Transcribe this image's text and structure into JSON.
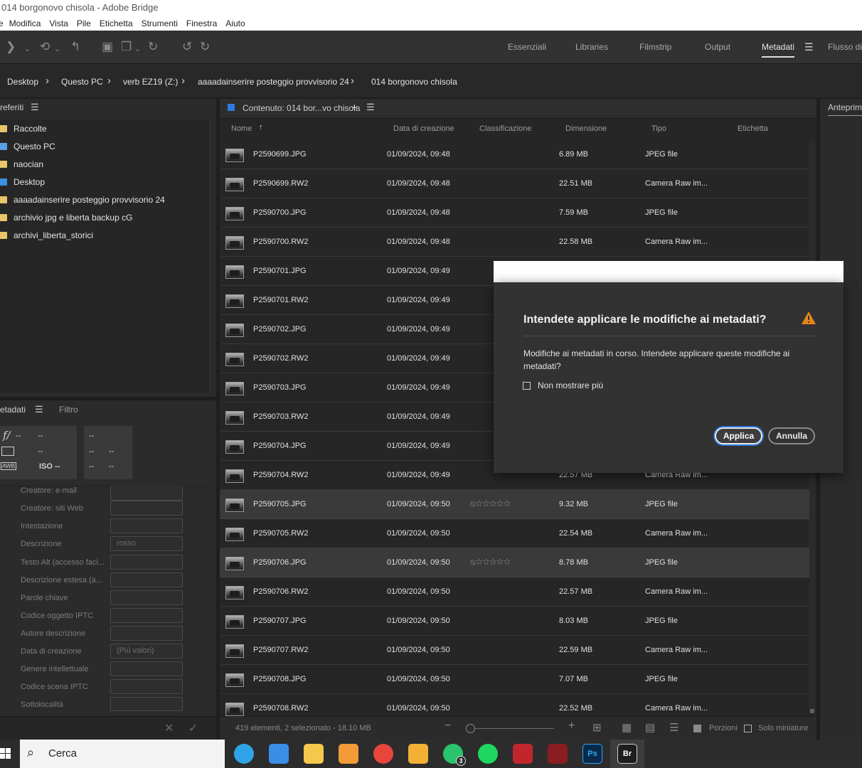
{
  "window": {
    "title": "014 borgonovo chisola - Adobe Bridge"
  },
  "menu": [
    "e",
    "Modifica",
    "Vista",
    "Pile",
    "Etichetta",
    "Strumenti",
    "Finestra",
    "Aiuto"
  ],
  "workspaces": [
    "Essenziali",
    "Libraries",
    "Filmstrip",
    "Output",
    "Metadati",
    "Flusso di l"
  ],
  "active_workspace": "Metadati",
  "breadcrumb": [
    "Desktop",
    "Questo PC",
    "verb EZ19 (Z:)",
    "aaaadainserire posteggio provvisorio 24",
    "014 borgonovo chisola"
  ],
  "favorites": {
    "tab": "referiti",
    "items": [
      {
        "label": "Raccolte",
        "icon": "collections-folder-icon",
        "color": "#e8c46a"
      },
      {
        "label": "Questo PC",
        "icon": "pc-icon",
        "color": "#5aa0e6"
      },
      {
        "label": "naocian",
        "icon": "folder-icon",
        "color": "#e8c46a"
      },
      {
        "label": "Desktop",
        "icon": "desktop-folder-icon",
        "color": "#3b8fe0"
      },
      {
        "label": "aaaadainserire posteggio provvisorio 24",
        "icon": "folder-icon",
        "color": "#e8c46a"
      },
      {
        "label": "archivio jpg e liberta backup cG",
        "icon": "folder-icon",
        "color": "#e8c46a"
      },
      {
        "label": "archivi_liberta_storici",
        "icon": "folder-icon",
        "color": "#e8c46a"
      }
    ]
  },
  "metadata_panel": {
    "tab_metadata": "etadati",
    "tab_filter": "Filtro",
    "camera": {
      "aperture_icon": "f/",
      "aperture": "--",
      "value2": "--",
      "metering": "--",
      "awb": "AWB",
      "iso": "ISO --",
      "b1": "--",
      "b2": "--",
      "b3": "--",
      "b4": "--",
      "b5": "--"
    },
    "fields": [
      {
        "label": "Creatore: e-mail",
        "value": ""
      },
      {
        "label": "Creatore: siti Web",
        "value": ""
      },
      {
        "label": "Intestazione",
        "value": ""
      },
      {
        "label": "Descrizione",
        "value": "rosso"
      },
      {
        "label": "Testo Alt (accesso faci...",
        "value": ""
      },
      {
        "label": "Descrizione estesa (a...",
        "value": ""
      },
      {
        "label": "Parole chiave",
        "value": ""
      },
      {
        "label": "Codice oggetto IPTC",
        "value": ""
      },
      {
        "label": "Autore descrizione",
        "value": ""
      },
      {
        "label": "Data di creazione",
        "value": "(Più valori)"
      },
      {
        "label": "Genere intellettuale",
        "value": ""
      },
      {
        "label": "Codice scena IPTC",
        "value": ""
      },
      {
        "label": "Sottolocalità",
        "value": ""
      }
    ]
  },
  "content": {
    "header": "Contenuto: 014 bor...vo chisola",
    "columns": [
      "Nome",
      "Data di creazione",
      "Classificazione",
      "Dimensione",
      "Tipo",
      "Etichetta"
    ],
    "rows": [
      {
        "name": "P2590699.JPG",
        "date": "01/09/2024, 09:48",
        "rating": "",
        "size": "6.89 MB",
        "type": "JPEG file",
        "selected": false
      },
      {
        "name": "P2590699.RW2",
        "date": "01/09/2024, 09:48",
        "rating": "",
        "size": "22.51 MB",
        "type": "Camera Raw im...",
        "selected": false
      },
      {
        "name": "P2590700.JPG",
        "date": "01/09/2024, 09:48",
        "rating": "",
        "size": "7.59 MB",
        "type": "JPEG file",
        "selected": false
      },
      {
        "name": "P2590700.RW2",
        "date": "01/09/2024, 09:48",
        "rating": "",
        "size": "22.58 MB",
        "type": "Camera Raw im...",
        "selected": false
      },
      {
        "name": "P2590701.JPG",
        "date": "01/09/2024, 09:49",
        "rating": "",
        "size": "",
        "type": "",
        "selected": false
      },
      {
        "name": "P2590701.RW2",
        "date": "01/09/2024, 09:49",
        "rating": "",
        "size": "",
        "type": "",
        "selected": false
      },
      {
        "name": "P2590702.JPG",
        "date": "01/09/2024, 09:49",
        "rating": "",
        "size": "",
        "type": "",
        "selected": false
      },
      {
        "name": "P2590702.RW2",
        "date": "01/09/2024, 09:49",
        "rating": "",
        "size": "",
        "type": "",
        "selected": false
      },
      {
        "name": "P2590703.JPG",
        "date": "01/09/2024, 09:49",
        "rating": "",
        "size": "",
        "type": "",
        "selected": false
      },
      {
        "name": "P2590703.RW2",
        "date": "01/09/2024, 09:49",
        "rating": "",
        "size": "",
        "type": "",
        "selected": false
      },
      {
        "name": "P2590704.JPG",
        "date": "01/09/2024, 09:49",
        "rating": "",
        "size": "",
        "type": "",
        "selected": false
      },
      {
        "name": "P2590704.RW2",
        "date": "01/09/2024, 09:49",
        "rating": "",
        "size": "22.57 MB",
        "type": "Camera Raw im...",
        "selected": false
      },
      {
        "name": "P2590705.JPG",
        "date": "01/09/2024, 09:50",
        "rating": "⦸☆☆☆☆☆",
        "size": "9.32 MB",
        "type": "JPEG file",
        "selected": true
      },
      {
        "name": "P2590705.RW2",
        "date": "01/09/2024, 09:50",
        "rating": "",
        "size": "22.54 MB",
        "type": "Camera Raw im...",
        "selected": false
      },
      {
        "name": "P2590706.JPG",
        "date": "01/09/2024, 09:50",
        "rating": "⦸☆☆☆☆☆",
        "size": "8.78 MB",
        "type": "JPEG file",
        "selected": true
      },
      {
        "name": "P2590706.RW2",
        "date": "01/09/2024, 09:50",
        "rating": "",
        "size": "22.57 MB",
        "type": "Camera Raw im...",
        "selected": false
      },
      {
        "name": "P2590707.JPG",
        "date": "01/09/2024, 09:50",
        "rating": "",
        "size": "8.03 MB",
        "type": "JPEG file",
        "selected": false
      },
      {
        "name": "P2590707.RW2",
        "date": "01/09/2024, 09:50",
        "rating": "",
        "size": "22.59 MB",
        "type": "Camera Raw im...",
        "selected": false
      },
      {
        "name": "P2590708.JPG",
        "date": "01/09/2024, 09:50",
        "rating": "",
        "size": "7.07 MB",
        "type": "JPEG file",
        "selected": false
      },
      {
        "name": "P2590708.RW2",
        "date": "01/09/2024, 09:50",
        "rating": "",
        "size": "22.52 MB",
        "type": "Camera Raw im...",
        "selected": false
      }
    ]
  },
  "status": {
    "text": "419 elementi, 2 selezionato - 18.10 MB",
    "portions": "Porzioni",
    "thumbs_only": "Solo miniature"
  },
  "preview": {
    "tab": "Anteprima"
  },
  "dialog": {
    "title": "Intendete applicare le modifiche ai metadati?",
    "message": "Modifiche ai metadati in corso. Intendete applicare queste modifiche ai metadati?",
    "checkbox": "Non mostrare più",
    "apply": "Applica",
    "cancel": "Annulla"
  },
  "taskbar": {
    "search": "Cerca",
    "apps": [
      {
        "icon": "edge-icon",
        "label": "",
        "color": "#2fa3e8"
      },
      {
        "icon": "store-icon",
        "label": "",
        "color": "#3a8ee6"
      },
      {
        "icon": "explorer-icon",
        "label": "",
        "color": "#f3c84b"
      },
      {
        "icon": "media-player-icon",
        "label": "",
        "color": "#f29b38"
      },
      {
        "icon": "chrome-icon",
        "label": "",
        "color": "#e8453c"
      },
      {
        "icon": "outlook-icon",
        "label": "",
        "color": "#f2b134"
      },
      {
        "icon": "whatsapp-icon",
        "label": "3",
        "color": "#29c46b"
      },
      {
        "icon": "spotify-icon",
        "label": "",
        "color": "#1ed760"
      },
      {
        "icon": "gpu-tweak-icon",
        "label": "",
        "color": "#c0272d"
      },
      {
        "icon": "gpu-tweak-2-icon",
        "label": "",
        "color": "#8a1d22"
      },
      {
        "icon": "photoshop-icon",
        "label": "Ps",
        "color": "#0a2a4a"
      },
      {
        "icon": "bridge-icon",
        "label": "Br",
        "color": "#1e1e1e"
      }
    ]
  }
}
